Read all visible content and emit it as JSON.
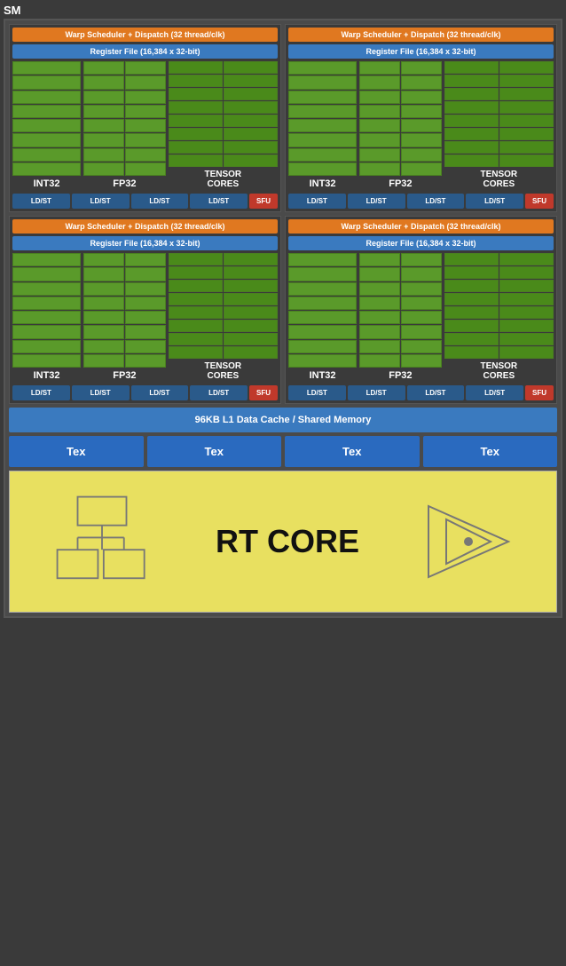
{
  "sm": {
    "label": "SM",
    "units": [
      {
        "id": "unit-tl",
        "warp_scheduler": "Warp Scheduler + Dispatch (32 thread/clk)",
        "register_file": "Register File (16,384 x 32-bit)",
        "int32_label": "INT32",
        "fp32_label": "FP32",
        "tensor_label": "TENSOR\nCORES",
        "ldst_units": [
          "LD/ST",
          "LD/ST",
          "LD/ST",
          "LD/ST"
        ],
        "sfu_label": "SFU"
      },
      {
        "id": "unit-tr",
        "warp_scheduler": "Warp Scheduler + Dispatch (32 thread/clk)",
        "register_file": "Register File (16,384 x 32-bit)",
        "int32_label": "INT32",
        "fp32_label": "FP32",
        "tensor_label": "TENSOR\nCORES",
        "ldst_units": [
          "LD/ST",
          "LD/ST",
          "LD/ST",
          "LD/ST"
        ],
        "sfu_label": "SFU"
      },
      {
        "id": "unit-bl",
        "warp_scheduler": "Warp Scheduler + Dispatch (32 thread/clk)",
        "register_file": "Register File (16,384 x 32-bit)",
        "int32_label": "INT32",
        "fp32_label": "FP32",
        "tensor_label": "TENSOR\nCORES",
        "ldst_units": [
          "LD/ST",
          "LD/ST",
          "LD/ST",
          "LD/ST"
        ],
        "sfu_label": "SFU"
      },
      {
        "id": "unit-br",
        "warp_scheduler": "Warp Scheduler + Dispatch (32 thread/clk)",
        "register_file": "Register File (16,384 x 32-bit)",
        "int32_label": "INT32",
        "fp32_label": "FP32",
        "tensor_label": "TENSOR\nCORES",
        "ldst_units": [
          "LD/ST",
          "LD/ST",
          "LD/ST",
          "LD/ST"
        ],
        "sfu_label": "SFU"
      }
    ],
    "l1_cache": "96KB L1 Data Cache / Shared Memory",
    "tex_units": [
      "Tex",
      "Tex",
      "Tex",
      "Tex"
    ],
    "rt_core_label": "RT CORE"
  }
}
